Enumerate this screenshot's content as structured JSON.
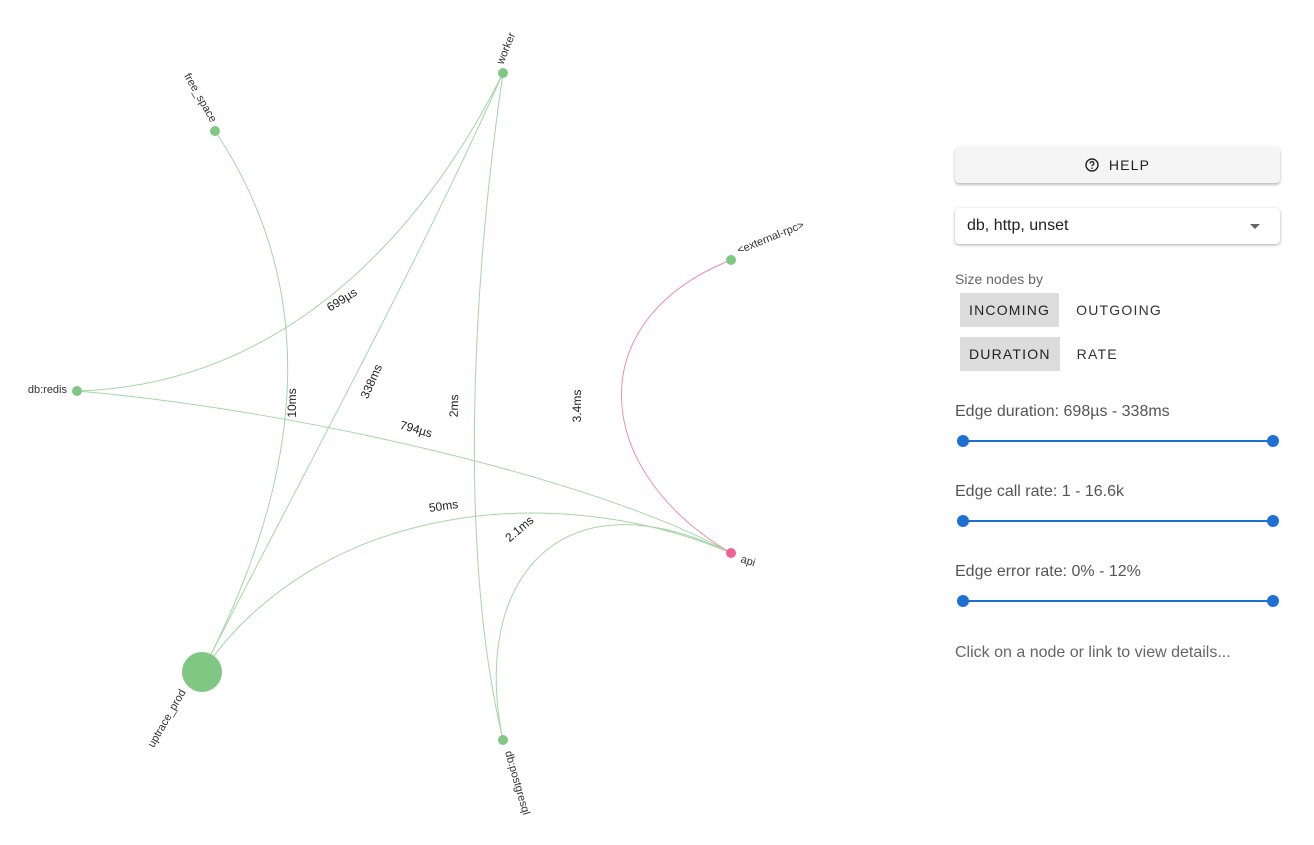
{
  "graph": {
    "nodes": [
      {
        "id": "worker",
        "label": "worker"
      },
      {
        "id": "free_space",
        "label": "free_space"
      },
      {
        "id": "external_rpc",
        "label": "<external-rpc>"
      },
      {
        "id": "db_redis",
        "label": "db:redis"
      },
      {
        "id": "api",
        "label": "api"
      },
      {
        "id": "uptrace_prod",
        "label": "uptrace_prod"
      },
      {
        "id": "db_postgresql",
        "label": "db:postgresql"
      }
    ],
    "edges": [
      {
        "source": "free_space",
        "target": "uptrace_prod",
        "label": "10ms",
        "color": "#a5d6a7"
      },
      {
        "source": "worker",
        "target": "db_redis",
        "label": "699µs",
        "color": "#a5d6a7"
      },
      {
        "source": "worker",
        "target": "uptrace_prod",
        "label": "338ms",
        "color": "#a5d6a7"
      },
      {
        "source": "worker",
        "target": "db_postgresql",
        "label": "2ms",
        "color": "#a5d6a7"
      },
      {
        "source": "db_redis",
        "target": "api",
        "label": "794µs",
        "color": "#a5d6a7"
      },
      {
        "source": "uptrace_prod",
        "target": "api",
        "label": "50ms",
        "color": "#a5d6a7"
      },
      {
        "source": "db_postgresql",
        "target": "api",
        "label": "2.1ms",
        "color": "#a5d6a7"
      },
      {
        "source": "external_rpc",
        "target": "api",
        "label": "3.4ms",
        "color": "#e991ab"
      }
    ],
    "colors": {
      "node_ok": "#81c784",
      "node_error": "#f06292"
    }
  },
  "panel": {
    "help_label": "HELP",
    "help_icon": "help-circle-icon",
    "filter_value": "db, http, unset",
    "size_nodes_by": "Size nodes by",
    "size_toggle": [
      "INCOMING",
      "OUTGOING"
    ],
    "size_toggle_active": "INCOMING",
    "metric_toggle": [
      "DURATION",
      "RATE"
    ],
    "metric_toggle_active": "DURATION",
    "edge_duration": "Edge duration: 698µs - 338ms",
    "edge_call_rate": "Edge call rate: 1 - 16.6k",
    "edge_error_rate": "Edge error rate: 0% - 12%",
    "hint": "Click on a node or link to view details...",
    "accent": "#1e6fd4"
  }
}
